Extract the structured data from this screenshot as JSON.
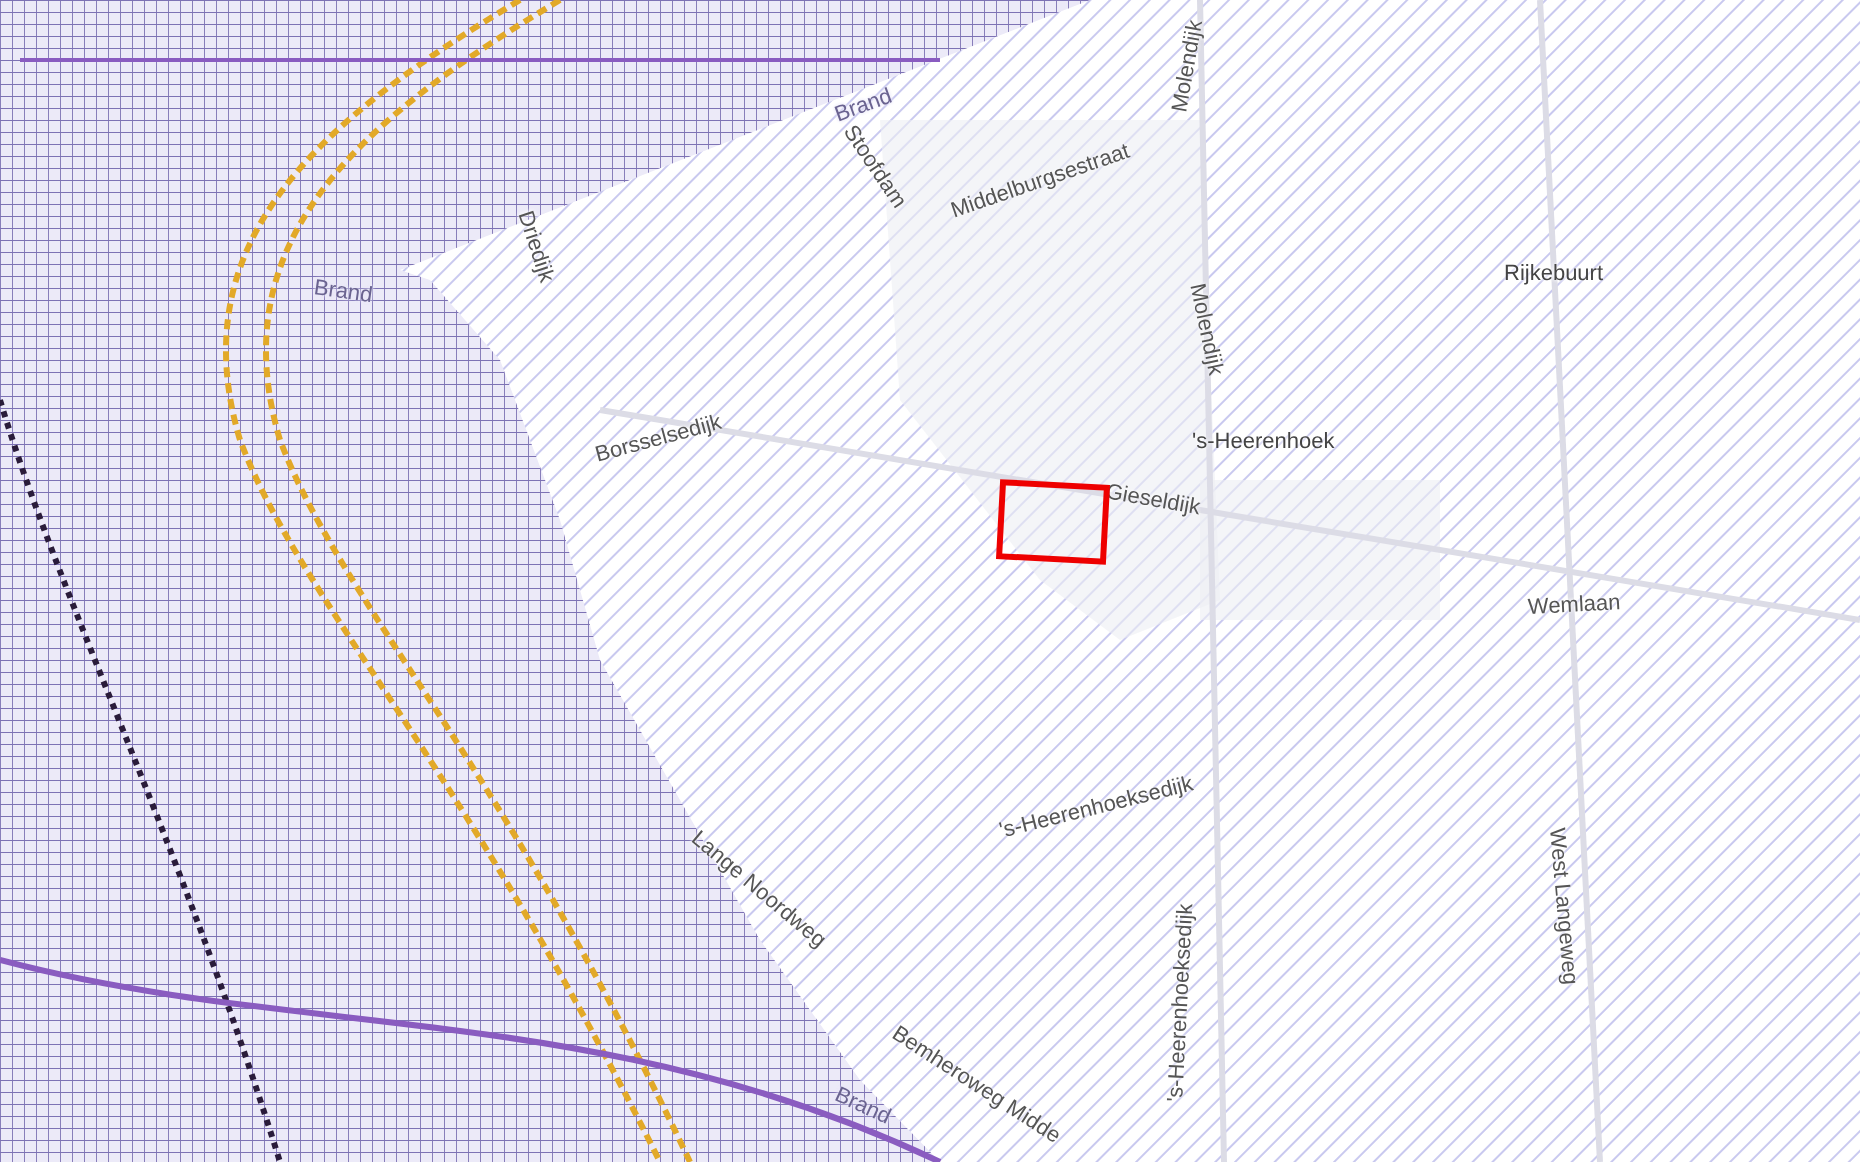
{
  "map": {
    "labels": [
      {
        "text": "Middelburgsestraat",
        "kind": "street"
      },
      {
        "text": "Stoofdam",
        "kind": "street"
      },
      {
        "text": "Molendijk",
        "kind": "street"
      },
      {
        "text": "Driedijk",
        "kind": "street"
      },
      {
        "text": "Borsselsedijk",
        "kind": "street"
      },
      {
        "text": "Molendijk",
        "kind": "street"
      },
      {
        "text": "'s-Heerenhoek",
        "kind": "place"
      },
      {
        "text": "Gieseldijk",
        "kind": "street"
      },
      {
        "text": "Rijkebuurt",
        "kind": "place"
      },
      {
        "text": "Wemlaan",
        "kind": "street"
      },
      {
        "text": "'s-Heerenhoeksedijk",
        "kind": "street"
      },
      {
        "text": "'s-Heerenhoeksedijk",
        "kind": "street"
      },
      {
        "text": "West Langeweg",
        "kind": "street"
      },
      {
        "text": "Lange Noordweg",
        "kind": "street"
      },
      {
        "text": "Bemheroweg Midde",
        "kind": "street"
      },
      {
        "text": "Brand",
        "kind": "zone"
      },
      {
        "text": "Brand",
        "kind": "zone"
      },
      {
        "text": "Brand",
        "kind": "zone"
      }
    ],
    "selection": {
      "shown": true
    }
  }
}
